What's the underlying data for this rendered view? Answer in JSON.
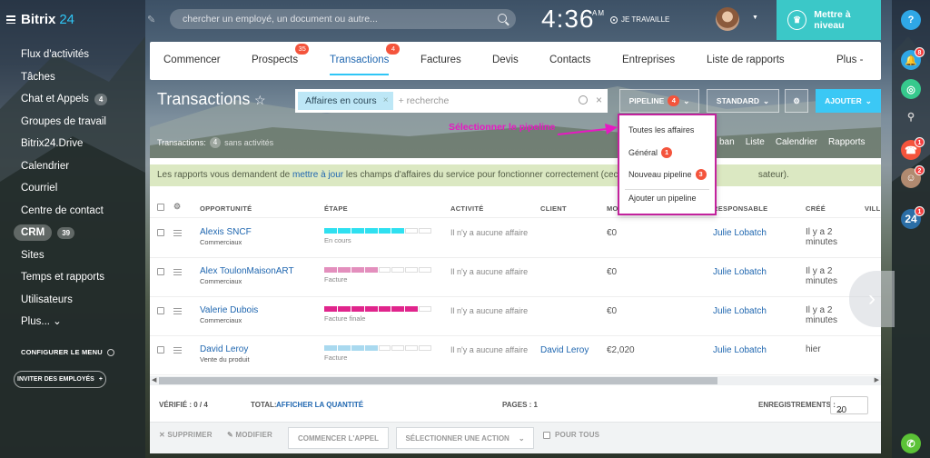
{
  "sidebar": {
    "logo_text": "Bitrix",
    "logo_num": "24",
    "items": [
      {
        "label": "Flux d'activités"
      },
      {
        "label": "Tâches"
      },
      {
        "label": "Chat et Appels",
        "count": "4"
      },
      {
        "label": "Groupes de travail"
      },
      {
        "label": "Bitrix24.Drive"
      },
      {
        "label": "Calendrier"
      },
      {
        "label": "Courriel"
      },
      {
        "label": "Centre de contact"
      },
      {
        "label": "CRM",
        "count": "39",
        "active": true
      },
      {
        "label": "Sites"
      },
      {
        "label": "Temps et rapports"
      },
      {
        "label": "Utilisateurs"
      },
      {
        "label": "Plus... ⌄"
      }
    ],
    "configure_menu": "CONFIGURER LE MENU",
    "invite": "INVITER DES EMPLOYÉS"
  },
  "topbar": {
    "search_placeholder": "chercher un employé, un document ou autre...",
    "time": "4:36",
    "ampm": "AM",
    "work_status": "JE TRAVAILLE",
    "upgrade": "Mettre à niveau"
  },
  "rightbar": {
    "help": "?",
    "notif_badge": "8",
    "call_badge": "1",
    "user_badge": "2",
    "b24_label": "24",
    "b24_badge": "1"
  },
  "tabs": [
    {
      "label": "Commencer"
    },
    {
      "label": "Prospects",
      "badge": "35"
    },
    {
      "label": "Transactions",
      "badge": "4",
      "active": true
    },
    {
      "label": "Factures"
    },
    {
      "label": "Devis"
    },
    {
      "label": "Contacts"
    },
    {
      "label": "Entreprises"
    },
    {
      "label": "Liste de rapports"
    },
    {
      "label": "Plus -"
    }
  ],
  "page": {
    "title": "Transactions",
    "filter_chip": "Affaires en cours",
    "filter_placeholder": "+ recherche",
    "pipeline_label": "PIPELINE",
    "pipeline_badge": "4",
    "standard_label": "STANDARD",
    "add_label": "AJOUTER",
    "subline_label": "Transactions:",
    "subline_count": "4",
    "subline_rest": "sans activités",
    "views": [
      "ban",
      "Liste",
      "Calendrier",
      "Rapports"
    ]
  },
  "warning": {
    "before": "Les rapports vous demandent de ",
    "link": "mettre à jour",
    "after": " les champs d'affaires du service pour fonctionner correctement (ceci n'affecte",
    "tail": "sateur)."
  },
  "table": {
    "headers": {
      "opportunity": "OPPORTUNITÉ",
      "stage": "ÉTAPE",
      "activity": "ACTIVITÉ",
      "client": "CLIENT",
      "amount": "MO",
      "responsible": "RESPONSABLE",
      "created": "CRÉÉ",
      "city": "VILL"
    },
    "rows": [
      {
        "name": "Alexis SNCF",
        "sub": "Commerciaux",
        "stage": "En cours",
        "stage_color": "#2fe0f0",
        "filled": 6,
        "activity": "Il n'y a aucune affaire",
        "client": "",
        "amount": "€0",
        "responsible": "Julie Lobatch",
        "created": "Il y a 2 minutes"
      },
      {
        "name": "Alex ToulonMaisonART",
        "sub": "Commerciaux",
        "stage": "Facture",
        "stage_color": "#e38fbd",
        "filled": 4,
        "activity": "Il n'y a aucune affaire",
        "client": "",
        "amount": "€0",
        "responsible": "Julie Lobatch",
        "created": "Il y a 2 minutes"
      },
      {
        "name": "Valerie Dubois",
        "sub": "Commerciaux",
        "stage": "Facture finale",
        "stage_color": "#e0258c",
        "filled": 7,
        "activity": "Il n'y a aucune affaire",
        "client": "",
        "amount": "€0",
        "responsible": "Julie Lobatch",
        "created": "Il y a 2 minutes"
      },
      {
        "name": "David Leroy",
        "sub": "Vente du produit",
        "stage": "Facture",
        "stage_color": "#a9d9ef",
        "filled": 4,
        "activity": "Il n'y a aucune affaire",
        "client": "David Leroy",
        "amount": "€2,020",
        "responsible": "Julie Lobatch",
        "created": "hier"
      }
    ]
  },
  "footer": {
    "verified": "VÉRIFIÉ : 0 / 4",
    "total": "TOTAL:",
    "show_qty": "AFFICHER LA QUANTITÉ",
    "pages": "PAGES : 1",
    "records": "ENREGISTREMENTS :",
    "per_page": "20"
  },
  "actions": {
    "delete": "SUPPRIMER",
    "edit": "MODIFIER",
    "start_call": "COMMENCER L'APPEL",
    "select_action": "SÉLECTIONNER UNE ACTION",
    "for_all": "POUR TOUS"
  },
  "dropdown": {
    "items": [
      {
        "label": "Toutes les affaires"
      },
      {
        "label": "Général",
        "badge": "1"
      },
      {
        "label": "Nouveau pipeline",
        "badge": "3"
      },
      {
        "label": "Ajouter un pipeline"
      }
    ]
  },
  "annotation": {
    "text": "Sélectionner le pipeline",
    "color": "#e619c2"
  }
}
